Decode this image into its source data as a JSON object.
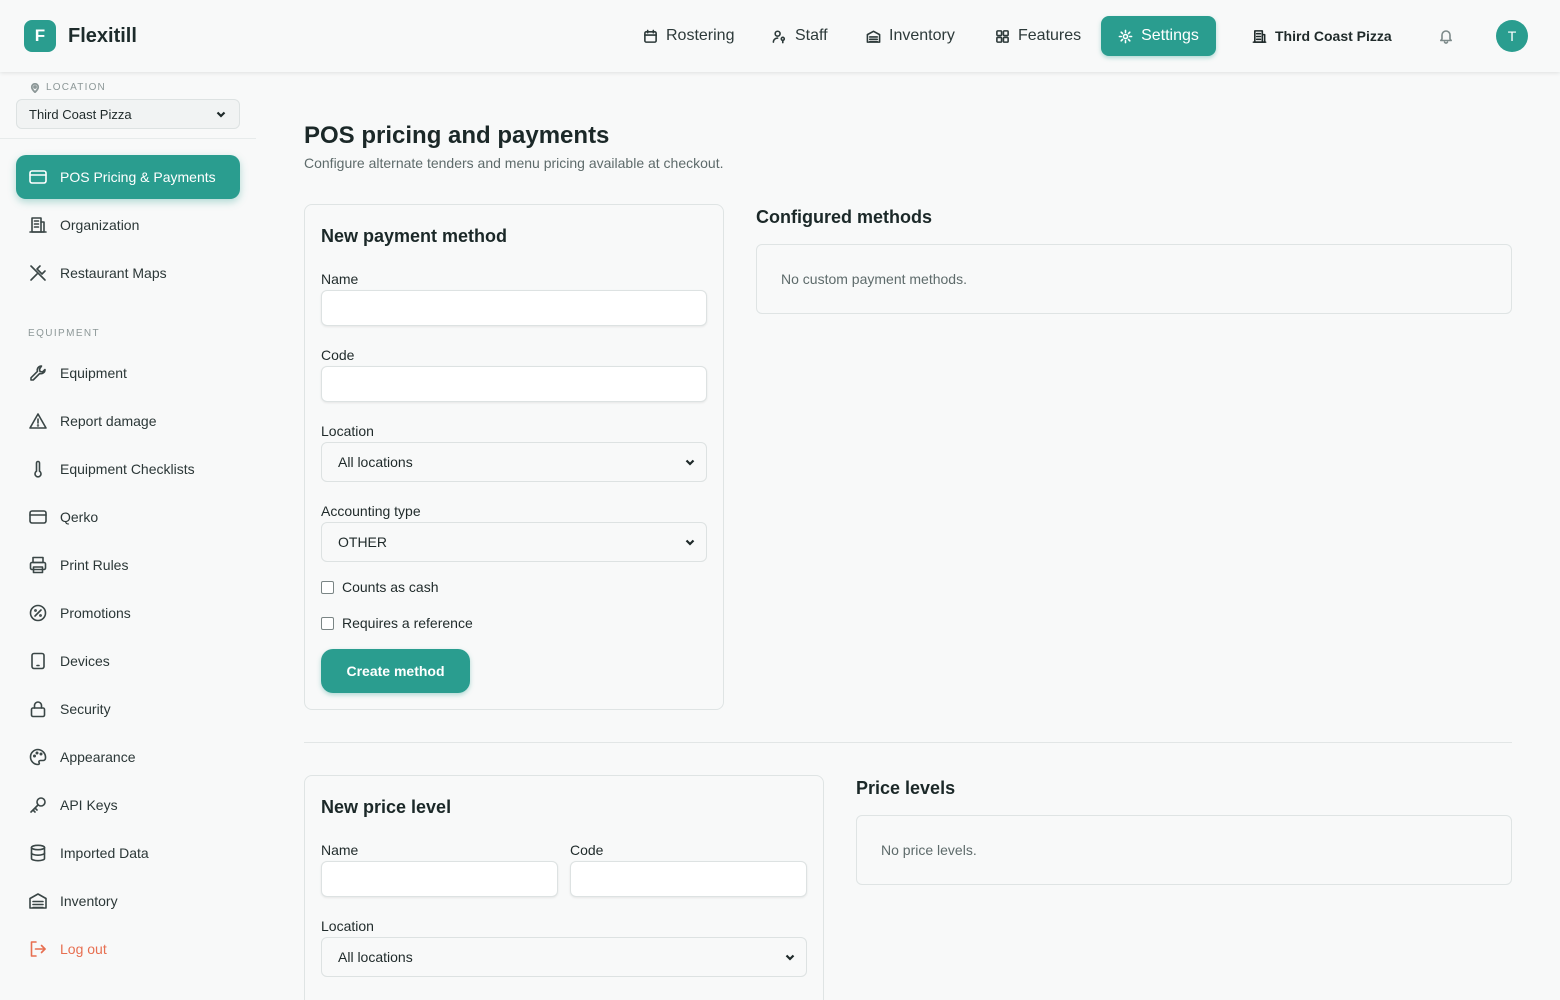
{
  "app": {
    "logo_letter": "F",
    "name": "Flexitill"
  },
  "nav": {
    "rostering": "Rostering",
    "staff": "Staff",
    "inventory": "Inventory",
    "features": "Features",
    "settings": "Settings",
    "location": "Third Coast Pizza",
    "avatar": "T"
  },
  "sidebar": {
    "location_label": "LOCATION",
    "location_value": "Third Coast Pizza",
    "section_equipment": "EQUIPMENT",
    "items": [
      {
        "label": "POS Pricing & Payments",
        "icon": "credit-card-icon"
      },
      {
        "label": "Organization",
        "icon": "building-icon"
      },
      {
        "label": "Restaurant Maps",
        "icon": "utensils-icon"
      },
      {
        "label": "Equipment",
        "icon": "wrench-icon"
      },
      {
        "label": "Report damage",
        "icon": "warning-icon"
      },
      {
        "label": "Equipment Checklists",
        "icon": "thermometer-icon"
      },
      {
        "label": "Qerko",
        "icon": "card-icon"
      },
      {
        "label": "Print Rules",
        "icon": "printer-icon"
      },
      {
        "label": "Promotions",
        "icon": "percent-badge-icon"
      },
      {
        "label": "Devices",
        "icon": "tablet-icon"
      },
      {
        "label": "Security",
        "icon": "lock-icon"
      },
      {
        "label": "Appearance",
        "icon": "palette-icon"
      },
      {
        "label": "API Keys",
        "icon": "key-icon"
      },
      {
        "label": "Imported Data",
        "icon": "database-icon"
      },
      {
        "label": "Inventory",
        "icon": "warehouse-icon"
      },
      {
        "label": "Log out",
        "icon": "logout-icon"
      }
    ]
  },
  "page": {
    "title": "POS pricing and payments",
    "subtitle": "Configure alternate tenders and menu pricing available at checkout."
  },
  "payment_form": {
    "title": "New payment method",
    "name_label": "Name",
    "name_value": "",
    "code_label": "Code",
    "code_value": "",
    "location_label": "Location",
    "location_value": "All locations",
    "accounting_label": "Accounting type",
    "accounting_value": "OTHER",
    "counts_cash_label": "Counts as cash",
    "requires_ref_label": "Requires a reference",
    "create_label": "Create method"
  },
  "configured": {
    "title": "Configured methods",
    "empty": "No custom payment methods."
  },
  "price_form": {
    "title": "New price level",
    "name_label": "Name",
    "code_label": "Code",
    "location_label": "Location",
    "location_value": "All locations"
  },
  "price_levels": {
    "title": "Price levels",
    "empty": "No price levels."
  },
  "colors": {
    "accent": "#2a9d8f",
    "danger": "#e76f51"
  }
}
